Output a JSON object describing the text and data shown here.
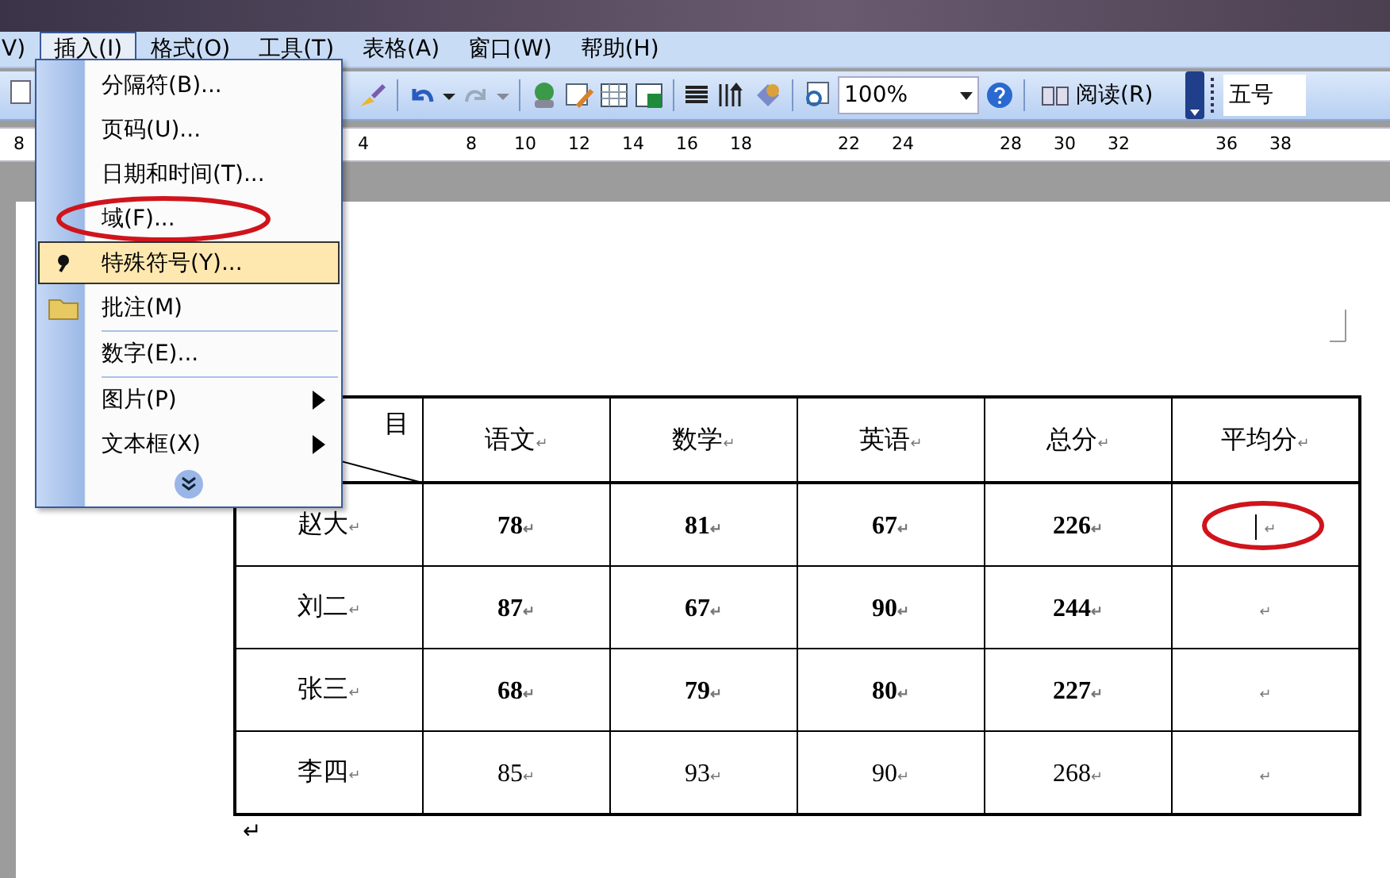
{
  "menu_bar": [
    {
      "label": "V)",
      "selected": false
    },
    {
      "label": "插入(I)",
      "selected": true
    },
    {
      "label": "格式(O)",
      "selected": false
    },
    {
      "label": "工具(T)",
      "selected": false
    },
    {
      "label": "表格(A)",
      "selected": false
    },
    {
      "label": "窗口(W)",
      "selected": false
    },
    {
      "label": "帮助(H)",
      "selected": false
    }
  ],
  "insert_menu": {
    "items": [
      {
        "label": "分隔符(B)...",
        "kind": "plain",
        "selected": false,
        "separator_before": false,
        "submenu": false,
        "circled": false
      },
      {
        "label": "页码(U)...",
        "kind": "plain",
        "selected": false,
        "separator_before": false,
        "submenu": false,
        "circled": false
      },
      {
        "label": "日期和时间(T)...",
        "kind": "plain",
        "selected": false,
        "separator_before": false,
        "submenu": false,
        "circled": false
      },
      {
        "label": "域(F)...",
        "kind": "plain",
        "selected": false,
        "separator_before": false,
        "submenu": false,
        "circled": true
      },
      {
        "label": "特殊符号(Y)...",
        "kind": "symbol",
        "selected": true,
        "separator_before": false,
        "submenu": false,
        "circled": false
      },
      {
        "label": "批注(M)",
        "kind": "folder",
        "selected": false,
        "separator_before": false,
        "submenu": false,
        "circled": false
      },
      {
        "label": "数字(E)...",
        "kind": "plain",
        "selected": false,
        "separator_before": true,
        "submenu": false,
        "circled": false
      },
      {
        "label": "图片(P)",
        "kind": "plain",
        "selected": false,
        "separator_before": true,
        "submenu": true,
        "circled": false
      },
      {
        "label": "文本框(X)",
        "kind": "plain",
        "selected": false,
        "separator_before": false,
        "submenu": true,
        "circled": false
      }
    ]
  },
  "toolbar": {
    "zoom": "100%",
    "read_button": "阅读(R)",
    "font_size": "五号"
  },
  "ruler": {
    "left_label": "8",
    "labels": [
      "4",
      "8",
      "10",
      "12",
      "14",
      "16",
      "18",
      "22",
      "24",
      "28",
      "30",
      "32",
      "36",
      "38"
    ]
  },
  "table": {
    "corner_label": "目",
    "columns": [
      {
        "label": "语文",
        "mark": "↵"
      },
      {
        "label": "数学",
        "mark": "↵"
      },
      {
        "label": "英语",
        "mark": "↵"
      },
      {
        "label": "总分",
        "mark": "↵"
      },
      {
        "label": "平均分",
        "mark": "↵"
      }
    ],
    "rows": [
      {
        "name": "赵大",
        "bold": true,
        "cells": [
          "78",
          "81",
          "67",
          "226"
        ],
        "mark": "↵",
        "average": {
          "mark": "↵",
          "cursor": true,
          "circled": true
        }
      },
      {
        "name": "刘二",
        "bold": true,
        "cells": [
          "87",
          "67",
          "90",
          "244"
        ],
        "mark": "↵",
        "average": {
          "mark": "↵",
          "cursor": false,
          "circled": false
        }
      },
      {
        "name": "张三",
        "bold": true,
        "cells": [
          "68",
          "79",
          "80",
          "227"
        ],
        "mark": "↵",
        "average": {
          "mark": "↵",
          "cursor": false,
          "circled": false
        }
      },
      {
        "name": "李四",
        "bold": false,
        "cells": [
          "85",
          "93",
          "90",
          "268"
        ],
        "mark": "↵",
        "average": {
          "mark": "↵",
          "cursor": false,
          "circled": false
        }
      }
    ]
  },
  "end_mark": "↵"
}
